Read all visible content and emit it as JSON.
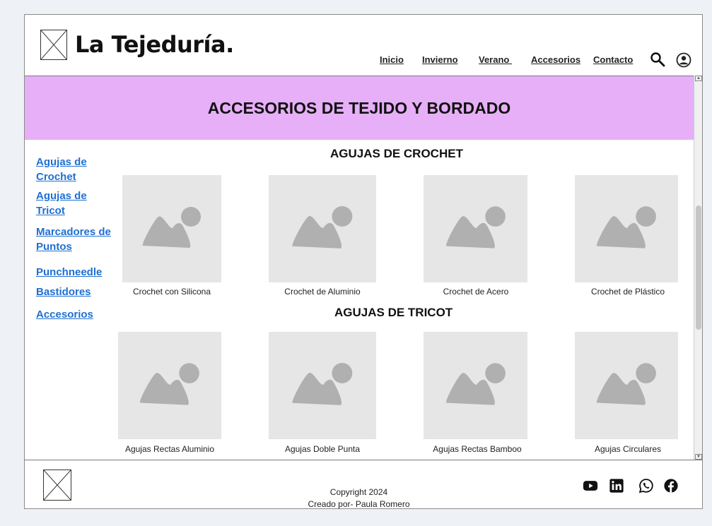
{
  "brand": {
    "name": "La Tejeduría."
  },
  "nav": {
    "items": [
      "Inicio",
      "Invierno",
      "Verano ",
      "Accesorios",
      "Contacto"
    ]
  },
  "banner": {
    "title": "ACCESORIOS DE TEJIDO Y BORDADO",
    "color": "#e7aff7"
  },
  "sidebar": {
    "items": [
      "Agujas de Crochet",
      "Agujas de Tricot",
      "Marcadores de Puntos",
      "Punchneedle",
      "Bastidores",
      "Accesorios"
    ]
  },
  "sections": [
    {
      "title": "AGUJAS DE CROCHET",
      "products": [
        "Crochet con Silicona",
        "Crochet de Aluminio",
        "Crochet de Acero",
        "Crochet de Plástico"
      ]
    },
    {
      "title": "AGUJAS DE TRICOT",
      "products": [
        "Agujas Rectas Aluminio",
        "Agujas Doble Punta",
        "Agujas Rectas Bamboo",
        "Agujas Circulares"
      ]
    }
  ],
  "footer": {
    "copyright": "Copyright 2024",
    "credit": "Creado por- Paula Romero"
  },
  "icons": [
    "search-icon",
    "user-icon",
    "youtube-icon",
    "linkedin-icon",
    "whatsapp-icon",
    "facebook-icon"
  ],
  "colors": {
    "link": "#1f6fd1",
    "banner": "#e7aff7",
    "placeholder": "#e6e6e6"
  }
}
